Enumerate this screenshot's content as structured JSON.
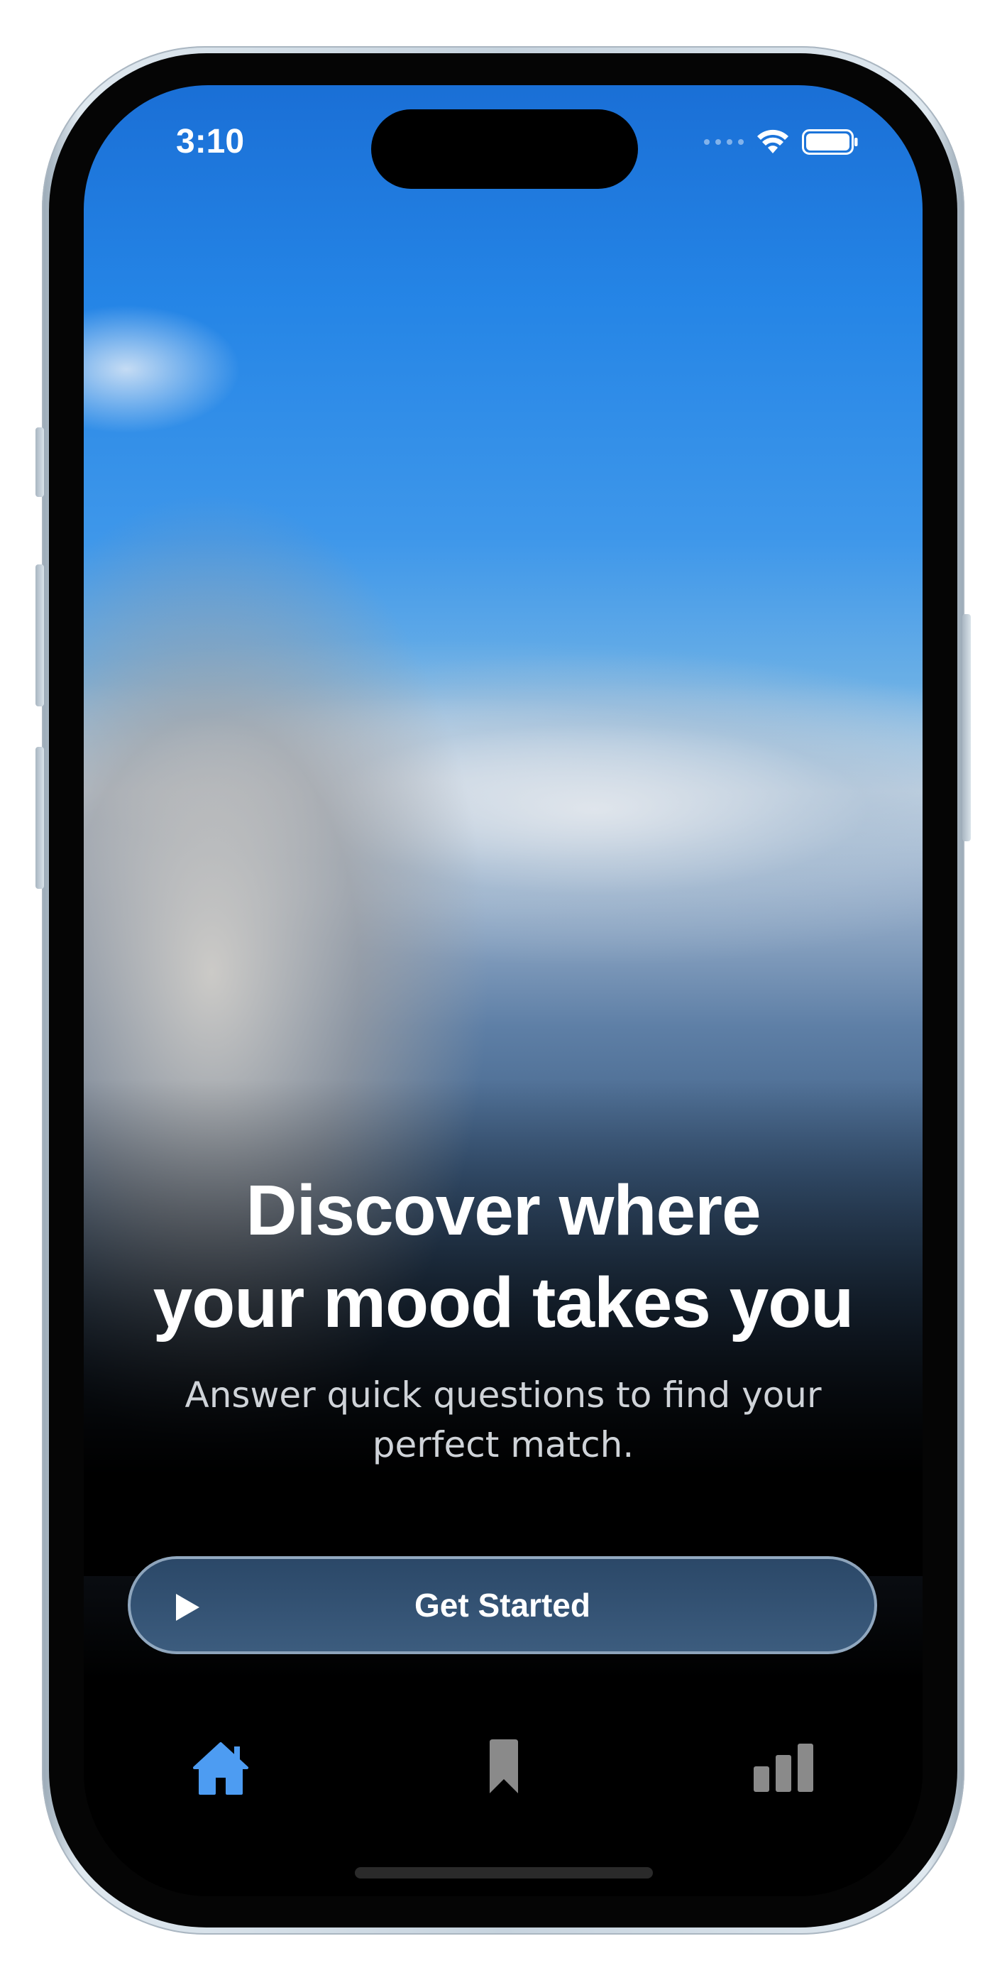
{
  "status_bar": {
    "time": "3:10"
  },
  "hero": {
    "headline_line1": "Discover where",
    "headline_line2": "your mood takes you",
    "subtitle_line1": "Answer quick questions to find your",
    "subtitle_line2": "perfect match."
  },
  "cta": {
    "label": "Get Started",
    "icon": "play-icon"
  },
  "tab_bar": {
    "items": [
      {
        "icon": "home-icon",
        "active": true
      },
      {
        "icon": "bookmark-icon",
        "active": false
      },
      {
        "icon": "stats-icon",
        "active": false
      }
    ],
    "active_color": "#4d9cf2",
    "inactive_color": "#8a8a8a"
  }
}
